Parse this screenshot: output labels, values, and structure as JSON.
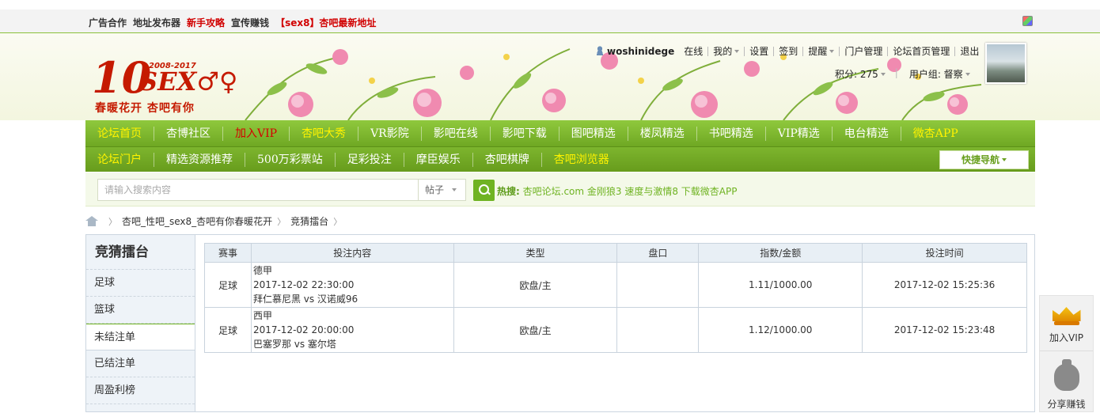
{
  "topbar": {
    "links": [
      {
        "label": "广告合作",
        "red": false
      },
      {
        "label": "地址发布器",
        "red": false
      },
      {
        "label": "新手攻略",
        "red": true
      },
      {
        "label": "宣传赚钱",
        "red": false
      },
      {
        "label": "【sex8】杏吧最新地址",
        "red": true
      }
    ]
  },
  "logo": {
    "big": "10",
    "years": "2008-2017",
    "sex": "SEX♂♀",
    "slogan": "春暖花开 杏吧有你"
  },
  "user": {
    "name": "woshinidege",
    "status": "在线",
    "menu": [
      "我的",
      "设置",
      "签到",
      "提醒",
      "门户管理",
      "论坛首页管理",
      "退出"
    ],
    "points_label": "积分: 275",
    "group_label": "用户组: 督察"
  },
  "nav1": [
    {
      "label": "论坛首页",
      "color": "yellow"
    },
    {
      "label": "杏博社区",
      "color": "white"
    },
    {
      "label": "加入VIP",
      "color": "red"
    },
    {
      "label": "杏吧大秀",
      "color": "yellow"
    },
    {
      "label": "VR影院",
      "color": "white"
    },
    {
      "label": "影吧在线",
      "color": "white"
    },
    {
      "label": "影吧下载",
      "color": "white"
    },
    {
      "label": "图吧精选",
      "color": "white"
    },
    {
      "label": "楼凤精选",
      "color": "white"
    },
    {
      "label": "书吧精选",
      "color": "white"
    },
    {
      "label": "VIP精选",
      "color": "white"
    },
    {
      "label": "电台精选",
      "color": "white"
    },
    {
      "label": "微杏APP",
      "color": "yellow"
    }
  ],
  "nav2": [
    {
      "label": "论坛门户",
      "color": "yellow"
    },
    {
      "label": "精选资源推荐",
      "color": "white"
    },
    {
      "label": "500万彩票站",
      "color": "white"
    },
    {
      "label": "足彩投注",
      "color": "white"
    },
    {
      "label": "摩臣娱乐",
      "color": "white"
    },
    {
      "label": "杏吧棋牌",
      "color": "white"
    },
    {
      "label": "杏吧浏览器",
      "color": "yellow"
    }
  ],
  "quicknav": {
    "label": "快捷导航"
  },
  "search": {
    "placeholder": "请输入搜索内容",
    "type": "帖子",
    "hot_label": "热搜:",
    "hot_terms": "杏吧论坛.com 金刚狼3 速度与激情8 下载微杏APP"
  },
  "breadcrumb": [
    "杏吧_性吧_sex8_杏吧有你春暖花开",
    "竞猜擂台"
  ],
  "sidebar": {
    "title": "竞猜擂台",
    "items": [
      "足球",
      "篮球",
      "未结注单",
      "已结注单",
      "周盈利榜"
    ],
    "active_index": 2
  },
  "table": {
    "headers": [
      "赛事",
      "投注内容",
      "类型",
      "盘口",
      "指数/金额",
      "投注时间"
    ],
    "rows": [
      {
        "event": "足球",
        "league": "德甲",
        "match_time": "2017-12-02 22:30:00",
        "teams": "拜仁慕尼黑 vs 汉诺威96",
        "type": "欧盘/主",
        "handicap": "",
        "odds_amount": "1.11/1000.00",
        "bet_time": "2017-12-02 15:25:36"
      },
      {
        "event": "足球",
        "league": "西甲",
        "match_time": "2017-12-02 20:00:00",
        "teams": "巴塞罗那 vs 塞尔塔",
        "type": "欧盘/主",
        "handicap": "",
        "odds_amount": "1.12/1000.00",
        "bet_time": "2017-12-02 15:23:48"
      }
    ]
  },
  "float": {
    "vip_label": "加入VIP",
    "share_label": "分享赚钱"
  }
}
